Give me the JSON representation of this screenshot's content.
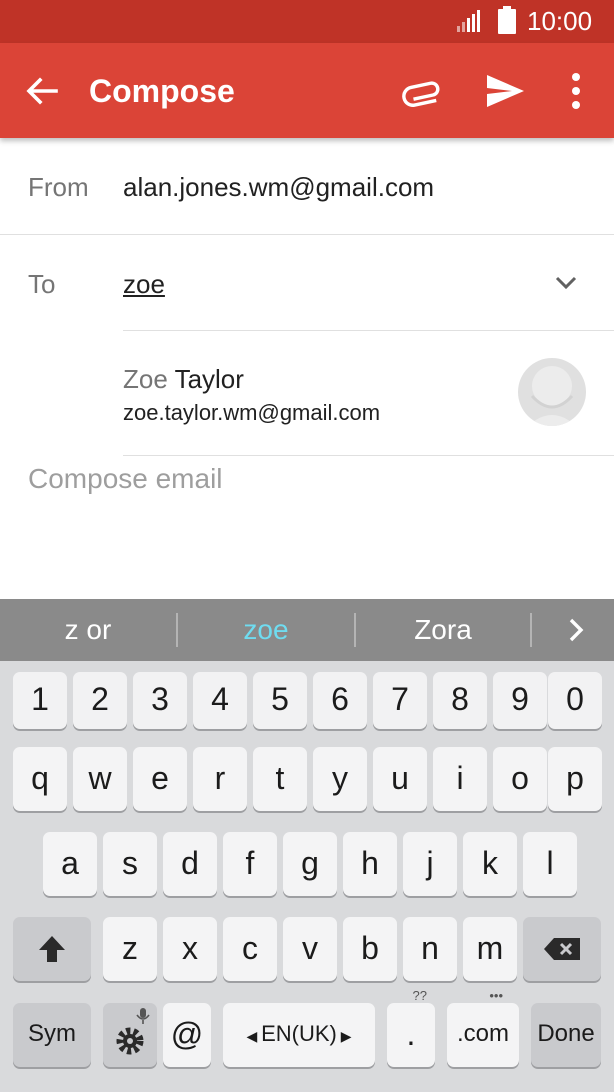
{
  "status_bar": {
    "time": "10:00"
  },
  "app_bar": {
    "title": "Compose"
  },
  "compose": {
    "from_label": "From",
    "from_value": "alan.jones.wm@gmail.com",
    "to_label": "To",
    "to_value": "zoe",
    "suggestion": {
      "name_match": "Zoe",
      "name_rest": " Taylor",
      "email": "zoe.taylor.wm@gmail.com"
    },
    "body_placeholder": "Compose email"
  },
  "keyboard": {
    "suggestions": [
      "z or",
      "zoe",
      "Zora"
    ],
    "row_numbers": [
      "1",
      "2",
      "3",
      "4",
      "5",
      "6",
      "7",
      "8",
      "9",
      "0"
    ],
    "row_q": [
      "q",
      "w",
      "e",
      "r",
      "t",
      "y",
      "u",
      "i",
      "o",
      "p"
    ],
    "row_a": [
      "a",
      "s",
      "d",
      "f",
      "g",
      "h",
      "j",
      "k",
      "l"
    ],
    "row_z": [
      "z",
      "x",
      "c",
      "v",
      "b",
      "n",
      "m"
    ],
    "sym_label": "Sym",
    "at_label": "@",
    "space_label": "EN(UK)",
    "period_label": ".",
    "period_hint": "??",
    "com_label": ".com",
    "done_label": "Done"
  },
  "colors": {
    "status_bar": "#bf3327",
    "app_bar": "#db4437",
    "suggestion_highlight": "#6fdcf0",
    "keyboard_bg": "#d9dadc"
  }
}
